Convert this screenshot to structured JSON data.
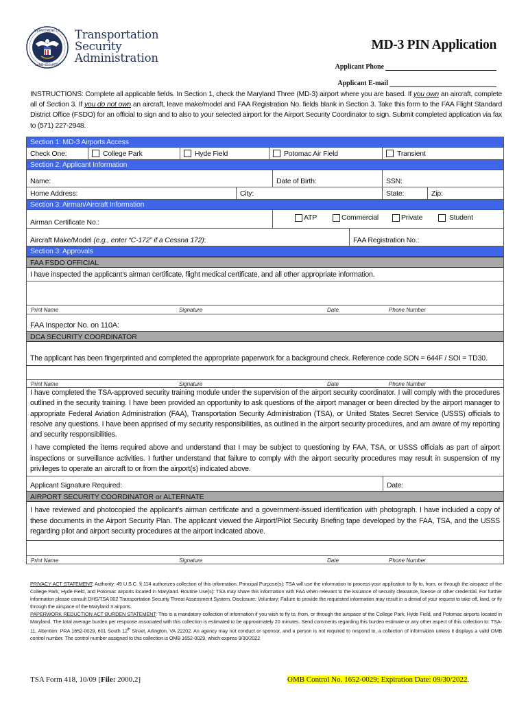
{
  "header": {
    "agency_lines": [
      "Transportation",
      "Security",
      "Administration"
    ],
    "seal_alt": "Department of Homeland Security seal",
    "title": "MD-3 PIN Application",
    "applicant_phone_label": "Applicant Phone",
    "applicant_phone_value": "",
    "applicant_email_label": "Applicant E-mail",
    "applicant_email_value": ""
  },
  "instructions": {
    "prefix": "INSTRUCTIONS:   Complete all applicable fields.  In Section 1, check the Maryland Three (MD-3) airport where you are based.  If ",
    "em1": "you own",
    "mid1": " an aircraft, complete all of Section 3. If ",
    "em2": "you do not own",
    "mid2": " an aircraft, leave make/model and FAA Registration No. fields blank in Section 3. Take this form to the FAA Flight Standard District Office (FSDO) for an official to sign and to also to your selected airport for the Airport Security Coordinator to sign. Submit completed application via fax to (571) 227-2948."
  },
  "section1": {
    "title": "Section 1:  MD-3 Airports Access",
    "check_one_label": "Check One:",
    "options": [
      {
        "label": "College Park",
        "checked": false
      },
      {
        "label": "Hyde Field",
        "checked": false
      },
      {
        "label": "Potomac Air Field",
        "checked": false
      },
      {
        "label": "Transient",
        "checked": false
      }
    ]
  },
  "section2": {
    "title": "Section 2:  Applicant Information",
    "name_label": "Name:",
    "dob_label": "Date of Birth:",
    "ssn_label": "SSN:",
    "address_label": "Home Address:",
    "city_label": "City:",
    "state_label": "State:",
    "zip_label": "Zip:"
  },
  "section3_airman": {
    "title": "Section 3:  Airman/Aircraft Information",
    "cert_no_label": "Airman Certificate No.:",
    "cert_types": [
      {
        "label": "ATP",
        "checked": false
      },
      {
        "label": "Commercial",
        "checked": false
      },
      {
        "label": "Private",
        "checked": false
      },
      {
        "label": "Student",
        "checked": false
      }
    ],
    "make_model_label": "Aircraft Make/Model ",
    "make_model_hint": "(e.g., enter “C-172” if a Cessna 172)",
    "make_model_colon": ":",
    "faa_reg_label": "FAA Registration No.:"
  },
  "section3_approvals": {
    "title": "Section 3:  Approvals",
    "signature_labels": [
      "Print Name",
      "Signature",
      "Date",
      "Phone Number"
    ],
    "fsdo": {
      "title": "FAA FSDO OFFICIAL",
      "statement": "I have inspected the applicant’s airman certificate, flight medical certificate, and all other appropriate information.",
      "inspector_label": "FAA Inspector No. on 110A:"
    },
    "dca": {
      "title": "DCA SECURITY COORDINATOR",
      "statement": "The applicant has been fingerprinted and completed the appropriate paperwork for a background check. Reference code SON = 644F / SOI = TD30."
    },
    "applicant_statement_1": "I have completed the TSA-approved security training module under the supervision of the airport security coordinator. I will comply with the procedures outlined in the security training. I have been provided an opportunity to ask questions of the airport manager or been directed by the airport manager to appropriate Federal Aviation Administration (FAA), Transportation Security Administration (TSA), or United States Secret Service (USSS) officials to resolve any questions.  I have been apprised of my security responsibilities, as outlined in the airport security procedures, and am aware of my reporting and security responsibilities.",
    "applicant_statement_2": "I have completed the items required above and understand that I may be subject to questioning by FAA, TSA, or USSS officials as part of airport inspections or surveillance activities. I further understand that failure to comply with the airport security procedures may result in suspension of my privileges to operate an aircraft to or from the airport(s) indicated above.",
    "applicant_signature_label": "Applicant Signature Required:",
    "applicant_date_label": "Date:",
    "asc": {
      "title": "AIRPORT SECURITY COORDINATOR or ALTERNATE",
      "statement": "I have reviewed and photocopied the applicant’s airman certificate and a government-issued identification with photograph.  I have included a copy of these documents in the Airport Security Plan. The applicant viewed the Airport/Pilot Security Briefing tape developed by the FAA, TSA, and the USSS regarding pilot and airport security procedures at the airport indicated above."
    }
  },
  "legal": {
    "privacy_heading": "PRIVACY ACT STATEMENT",
    "privacy_text": ": Authority: 49 U.S.C. § 114 authorizes collection of this information. Principal Purpose(s):  TSA will use the information to process your application to fly to, from, or through the airspace of the College Park, Hyde Field, and Potomac airports located in Maryland. Routine Use(s): TSA may share this information with FAA when relevant to the issuance of security clearance, license or other credential. For further information please consult DHS/TSA 002 Transportation Security Threat Assessment System. Disclosure: Voluntary; Failure to provide the requested information may result in a denial of your request to take off, land, or fly through the airspace of the Maryland 3 airports.",
    "pra_heading": "PAPERWORK REDUCTION ACT BURDEN STATEMENT",
    "pra_text_1": ": This is a mandatory collection of information if you wish to fly to, from, or through the airspace of the College Park, Hyde Field, and Potomac airports located in Maryland. The total average burden per response associated with this collection is estimated to be approximately 20 minutes.  Send comments regarding this burden estimate or any other aspect of this collection to: TSA-11, Attention: PRA 1652-0029, 601 South 12",
    "pra_sup": "th",
    "pra_text_2": " Street, Arlington, VA 22202. An agency may not conduct or sponsor, and a person is not required to respond to, a collection of information unless it displays a valid OMB control number. The control number assigned to this collection is OMB 1652-0029, which expires 9/30/2022"
  },
  "footer": {
    "form_id": "TSA Form 418, 10/09 [",
    "file_label": "File:",
    "file_value": " 2000.2]",
    "omb": "OMB Control No. 1652-0029; Expiration Date: 09/30/2022",
    "omb_period": "."
  }
}
